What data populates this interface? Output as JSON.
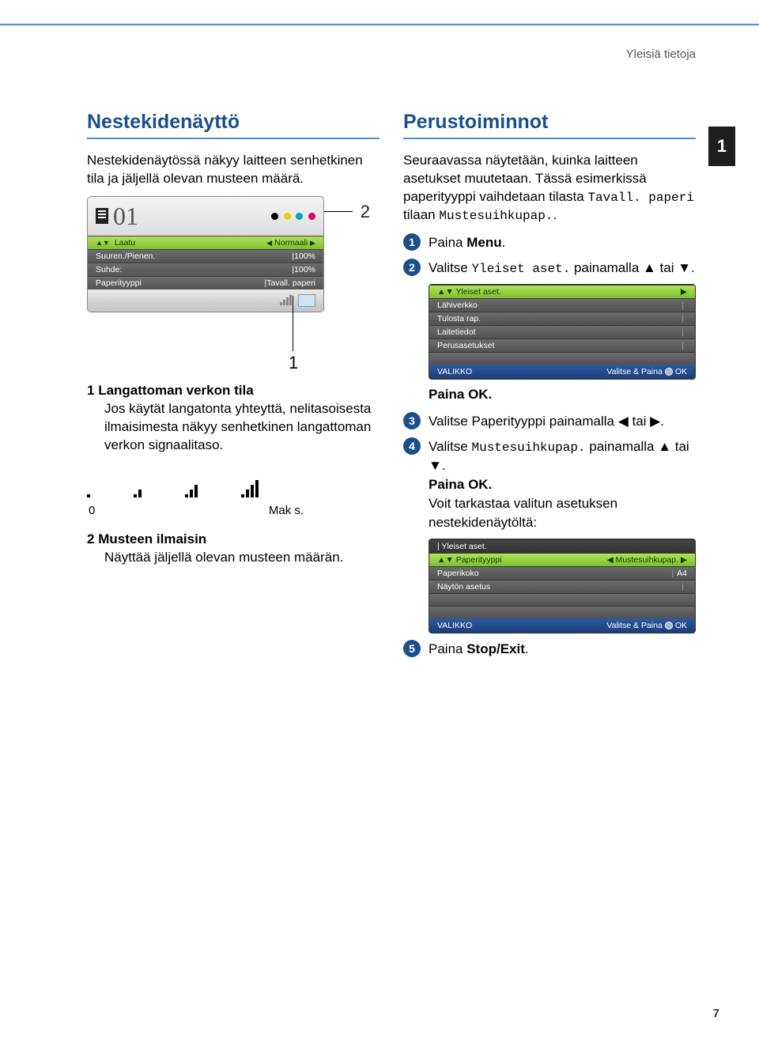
{
  "page": {
    "header_label": "Yleisiä tietoja",
    "chapter_number": "1",
    "page_number": "7"
  },
  "left": {
    "heading": "Nestekidenäyttö",
    "intro": "Nestekidenäytössä näkyy laitteen senhetkinen tila ja jäljellä olevan musteen määrä.",
    "lcd": {
      "title": "01",
      "rows": [
        {
          "label": "Laatu",
          "value": "Normaali",
          "hi": true
        },
        {
          "label": "Suuren./Pienen.",
          "value": "100%"
        },
        {
          "label": "Suhde:",
          "value": "100%"
        },
        {
          "label": "Paperityyppi",
          "value": "Tavall. paperi"
        }
      ],
      "callout2": "2",
      "callout1": "1"
    },
    "items": [
      {
        "num": "1",
        "title": "Langattoman verkon tila",
        "body": "Jos käytät langatonta yhteyttä, nelitasoisesta ilmaisimesta näkyy senhetkinen langattoman verkon signaalitaso."
      },
      {
        "num": "2",
        "title": "Musteen ilmaisin",
        "body": "Näyttää jäljellä olevan musteen määrän."
      }
    ],
    "signal": {
      "min_label": "0",
      "max_label": "Mak s."
    }
  },
  "right": {
    "heading": "Perustoiminnot",
    "intro_pre": "Seuraavassa näytetään, kuinka laitteen asetukset muutetaan. Tässä esimerkissä paperityyppi vaihdetaan tilasta ",
    "intro_code1": "Tavall. paperi",
    "intro_mid": " tilaan ",
    "intro_code2": "Mustesuihkupap.",
    "intro_post": ".",
    "steps": {
      "s1": {
        "pre": "Paina ",
        "bold": "Menu",
        "post": "."
      },
      "s2": {
        "pre": "Valitse ",
        "code": "Yleiset aset.",
        "post": " painamalla ▲ tai ▼."
      },
      "s2_ok": "Paina OK.",
      "s3": {
        "txt": "Valitse Paperityyppi painamalla ◀ tai ▶."
      },
      "s4": {
        "pre": "Valitse ",
        "code": "Mustesuihkupap.",
        "post": " painamalla ▲ tai ▼.",
        "ok": "Paina OK.",
        "note": "Voit tarkastaa valitun asetuksen nestekidenäytöltä:"
      },
      "s5": {
        "pre": "Paina ",
        "bold": "Stop/Exit",
        "post": "."
      }
    },
    "lcd_a": {
      "rows": [
        {
          "label": "Yleiset aset.",
          "hi": true
        },
        {
          "label": "Lähiverkko"
        },
        {
          "label": "Tulosta rap."
        },
        {
          "label": "Laitetiedot"
        },
        {
          "label": "Perusasetukset"
        }
      ],
      "footer_left": "VALIKKO",
      "footer_right": "Valitse & Paina",
      "footer_ok": "OK"
    },
    "lcd_b": {
      "header": "Yleiset aset.",
      "rows": [
        {
          "label": "Paperityyppi",
          "value": "Mustesuihkupap.",
          "hi": true
        },
        {
          "label": "Paperikoko",
          "value": "A4"
        },
        {
          "label": "Näytön asetus"
        }
      ],
      "footer_left": "VALIKKO",
      "footer_right": "Valitse & Paina",
      "footer_ok": "OK"
    }
  }
}
